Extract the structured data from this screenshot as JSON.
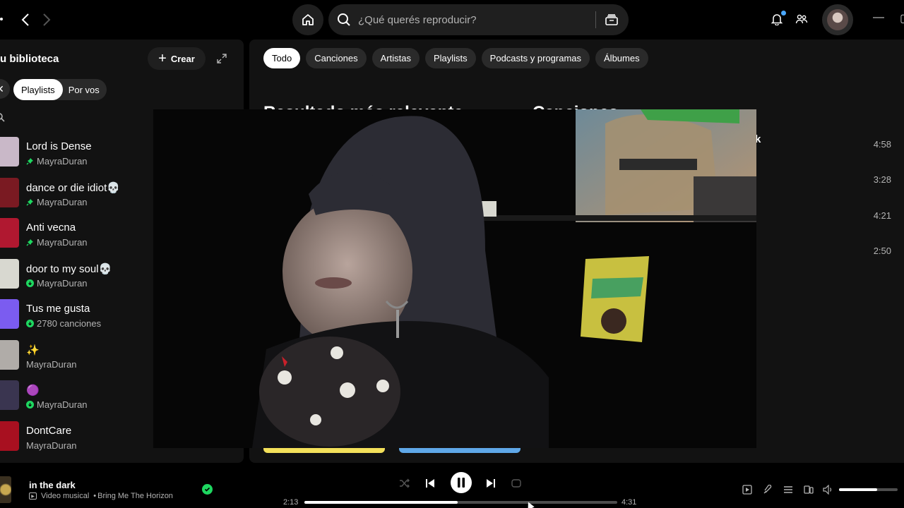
{
  "topbar": {
    "search_placeholder": "¿Qué querés reproducir?",
    "icons": [
      "chevron-left-icon",
      "chevron-right-icon",
      "home-icon",
      "search-icon",
      "browse-icon",
      "bell-icon",
      "friends-icon",
      "avatar"
    ]
  },
  "library": {
    "title": "Tu biblioteca",
    "title_visible": "u biblioteca",
    "create_label": "Crear",
    "filters": [
      "Playlists",
      "Por vos"
    ],
    "items": [
      {
        "name": "Lord is Dense",
        "meta": "MayraDuran",
        "status": "pinned",
        "cover": "#c9b8c8"
      },
      {
        "name": "dance or die idiot💀",
        "meta": "MayraDuran",
        "status": "pinned",
        "cover": "#7a1a22"
      },
      {
        "name": "Anti vecna",
        "meta": "MayraDuran",
        "status": "pinned",
        "cover": "#b01830"
      },
      {
        "name": "door to my soul💀",
        "meta": "MayraDuran",
        "status": "downloaded",
        "cover": "#d8d8d0"
      },
      {
        "name": "Tus me gusta",
        "meta": "2780 canciones",
        "status": "downloaded",
        "cover": "#7b5cf0"
      },
      {
        "name": "✨",
        "meta": "MayraDuran",
        "status": "none",
        "cover": "#b0aca8"
      },
      {
        "name": "🟣",
        "meta": "MayraDuran",
        "status": "downloaded",
        "cover": "#3a3550"
      },
      {
        "name": "DontCare",
        "meta": "MayraDuran",
        "status": "none",
        "cover": "#a81020"
      }
    ]
  },
  "main": {
    "chips": [
      "Todo",
      "Canciones",
      "Artistas",
      "Playlists",
      "Podcasts y programas",
      "Álbumes"
    ],
    "active_chip": "Todo",
    "top_result_heading": "Resultado más relevante",
    "songs_heading": "Canciones",
    "song_fragment": "k",
    "durations": [
      "4:58",
      "3:28",
      "4:21",
      "2:50"
    ]
  },
  "player": {
    "title": "in the dark",
    "type": "Video musical",
    "artist": "Bring Me The Horizon",
    "elapsed": "2:13",
    "total": "4:31",
    "progress": 0.49,
    "volume": 0.65
  }
}
